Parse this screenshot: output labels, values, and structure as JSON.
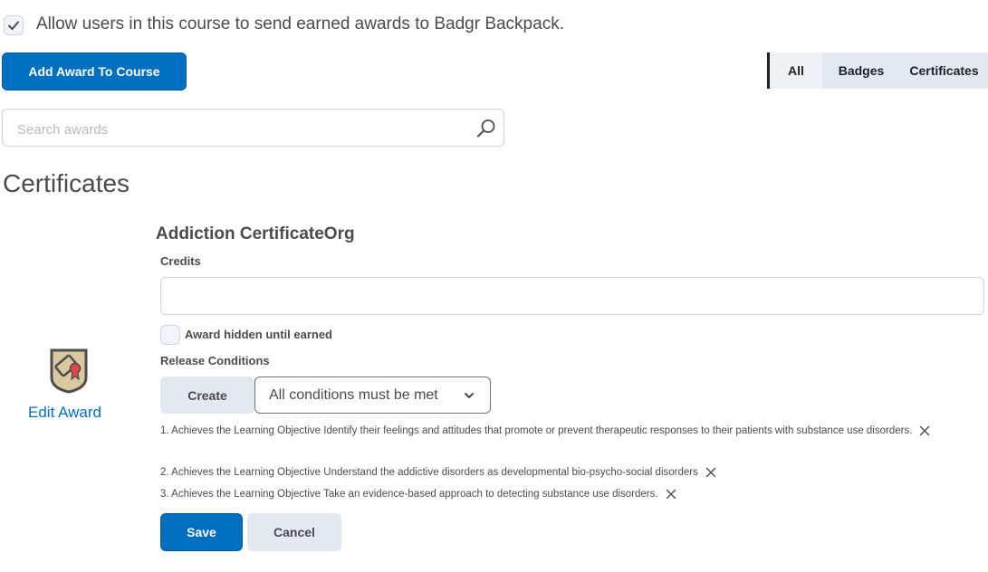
{
  "settings": {
    "allow_backpack_label": "Allow users in this course to send earned awards to Badgr Backpack.",
    "allow_backpack_checked": true
  },
  "toolbar": {
    "add_award_label": "Add Award To Course",
    "filters": [
      "All",
      "Badges",
      "Certificates"
    ],
    "active_filter": "All"
  },
  "search": {
    "placeholder": "Search awards",
    "value": ""
  },
  "section": {
    "title": "Certificates"
  },
  "award": {
    "title": "Addiction CertificateOrg",
    "icon": "certificate-badge-icon",
    "edit_label": "Edit Award",
    "credits_label": "Credits",
    "credits_value": "",
    "hidden_label": "Award hidden until earned",
    "hidden_checked": false,
    "release_conditions_label": "Release Conditions",
    "create_label": "Create",
    "conditions_select": "All conditions must be met",
    "conditions": [
      "1. Achieves the Learning Objective Identify their feelings and attitudes that promote or prevent therapeutic responses to their patients with substance use disorders.",
      "2. Achieves the Learning Objective Understand the addictive disorders as developmental bio-psycho-social disorders",
      "3. Achieves the Learning Objective Take an evidence-based approach to detecting substance use disorders."
    ],
    "save_label": "Save",
    "cancel_label": "Cancel"
  },
  "colors": {
    "primary": "#006fbf",
    "secondary_bg": "#e3e9f1",
    "text": "#494c4e"
  }
}
